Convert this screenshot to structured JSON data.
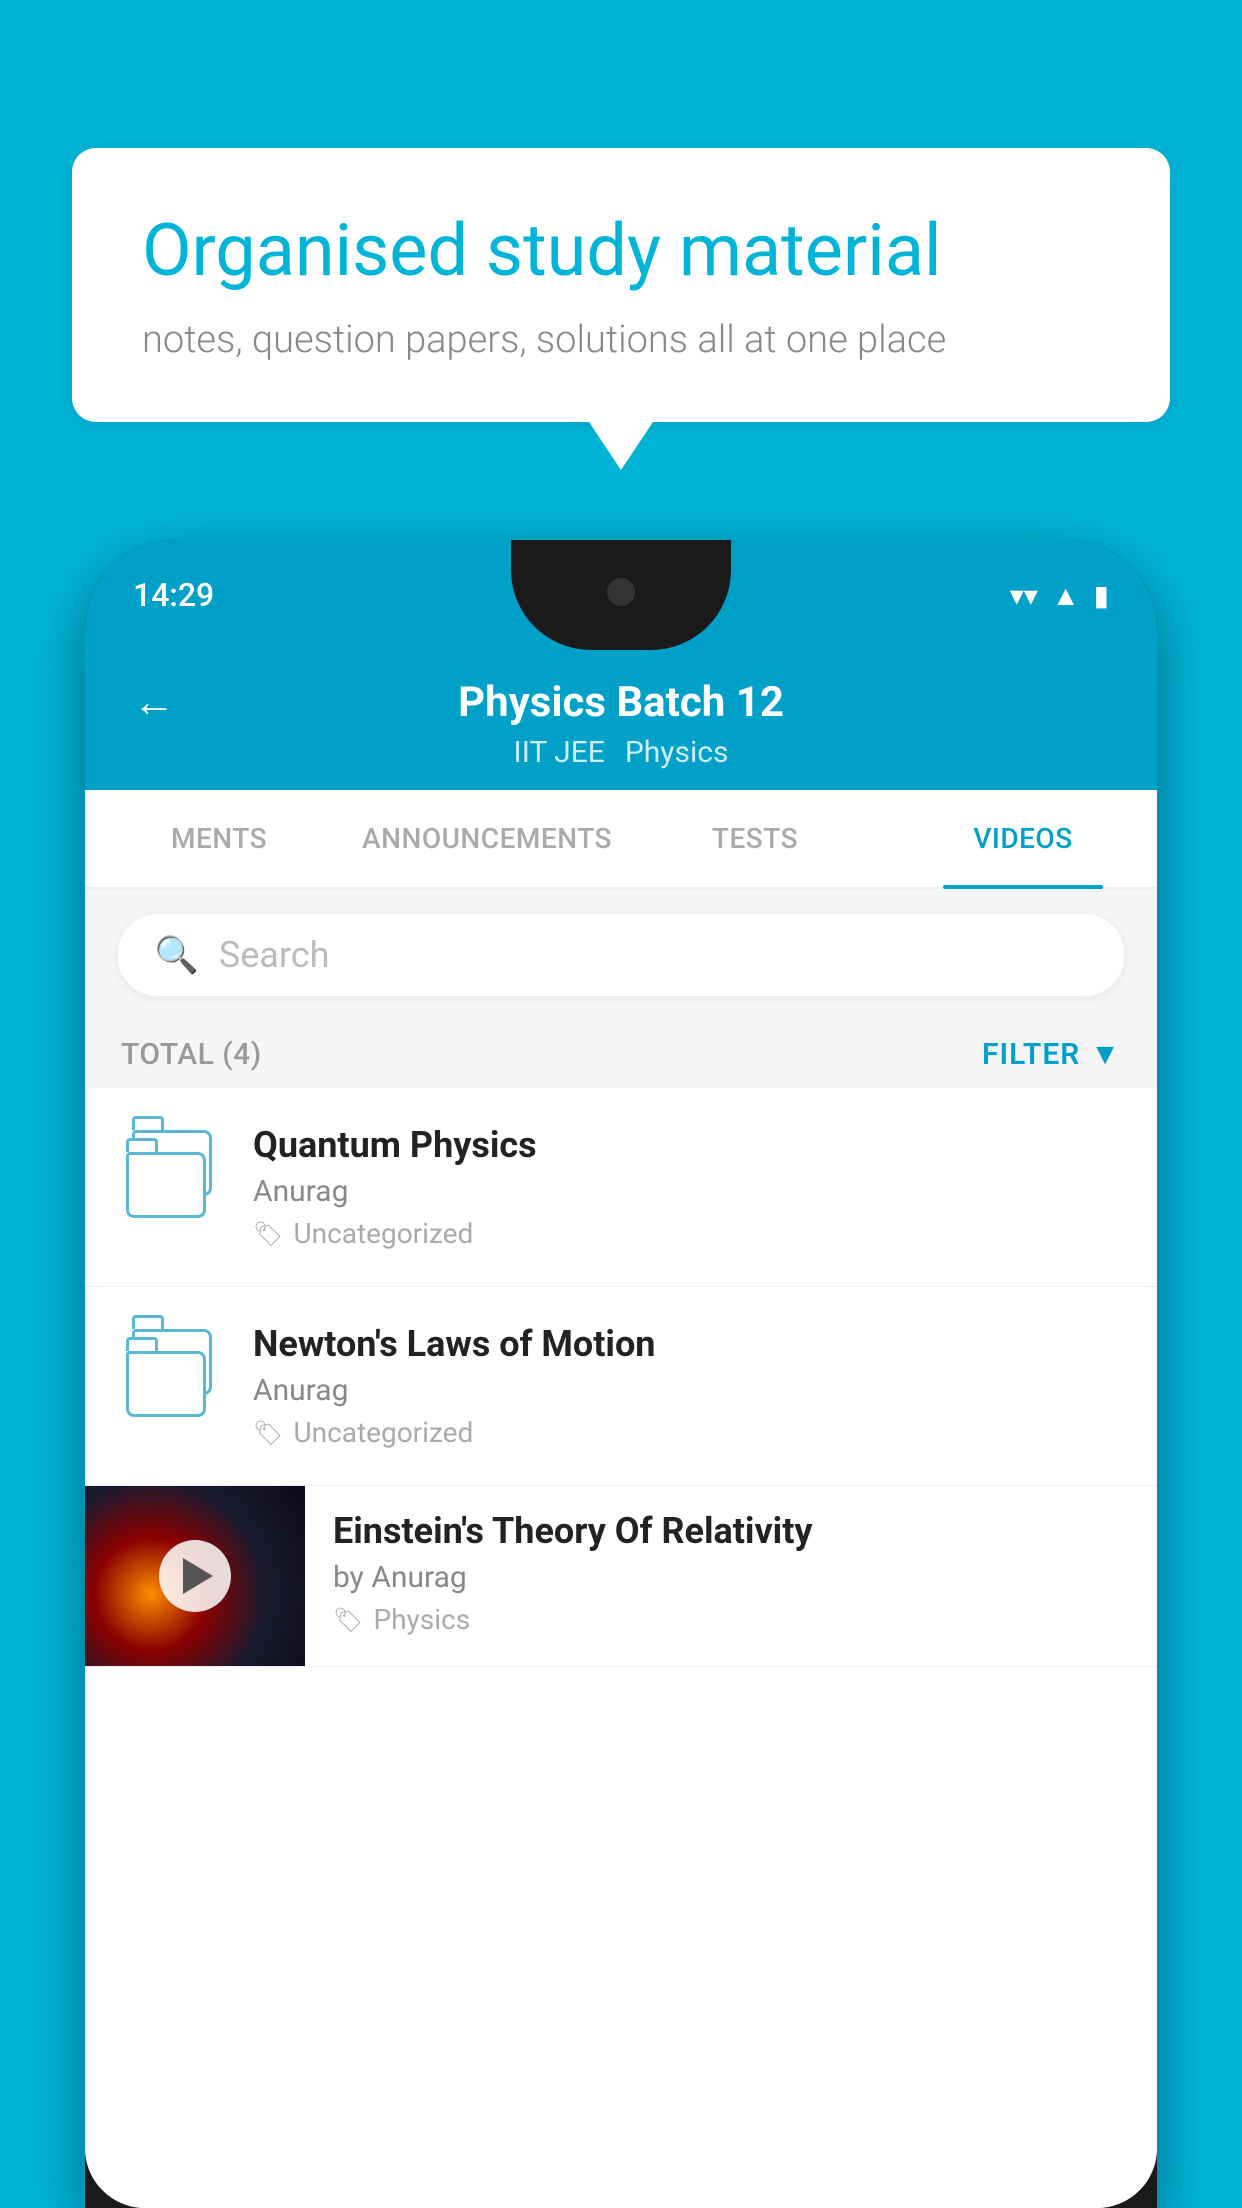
{
  "background_color": "#00b4d8",
  "speech_bubble": {
    "title": "Organised study material",
    "subtitle": "notes, question papers, solutions all at one place"
  },
  "phone": {
    "status_bar": {
      "time": "14:29",
      "wifi": "▼",
      "signal": "▲",
      "battery": "▮"
    },
    "header": {
      "back_label": "←",
      "title": "Physics Batch 12",
      "subtitle_left": "IIT JEE",
      "subtitle_right": "Physics"
    },
    "tabs": [
      {
        "label": "MENTS",
        "active": false
      },
      {
        "label": "ANNOUNCEMENTS",
        "active": false
      },
      {
        "label": "TESTS",
        "active": false
      },
      {
        "label": "VIDEOS",
        "active": true
      }
    ],
    "search": {
      "placeholder": "Search"
    },
    "filter_bar": {
      "total_label": "TOTAL (4)",
      "filter_label": "FILTER"
    },
    "videos": [
      {
        "title": "Quantum Physics",
        "author": "Anurag",
        "tag": "Uncategorized",
        "has_thumbnail": false
      },
      {
        "title": "Newton's Laws of Motion",
        "author": "Anurag",
        "tag": "Uncategorized",
        "has_thumbnail": false
      },
      {
        "title": "Einstein's Theory Of Relativity",
        "author": "by Anurag",
        "tag": "Physics",
        "has_thumbnail": true
      }
    ]
  }
}
